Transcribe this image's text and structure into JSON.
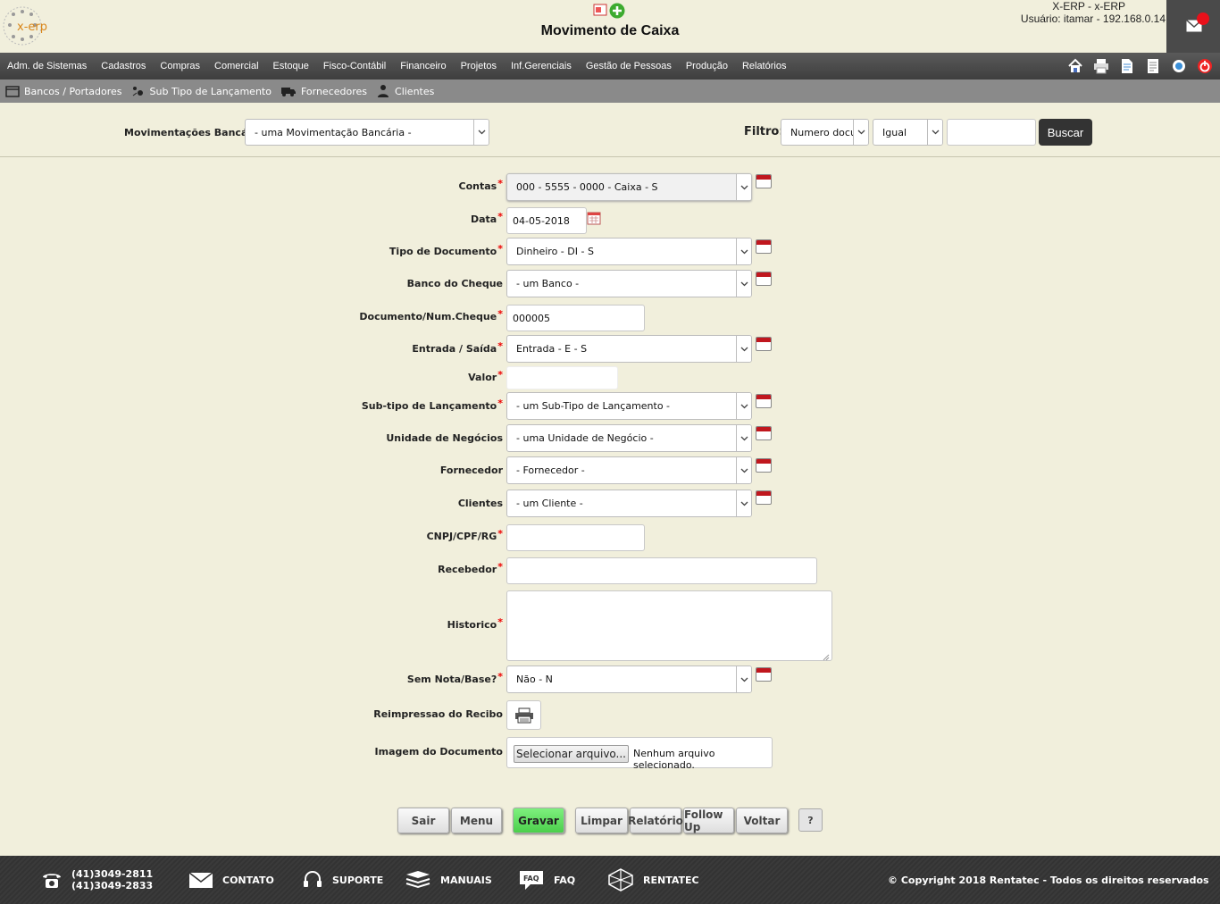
{
  "header": {
    "title": "Movimento de Caixa",
    "system_name": "X-ERP - x-ERP",
    "user_info": "Usuário: itamar - 192.168.0.14",
    "logo_text": "x-erp"
  },
  "menu": [
    "Adm. de Sistemas",
    "Cadastros",
    "Compras",
    "Comercial",
    "Estoque",
    "Fisco-Contábil",
    "Financeiro",
    "Projetos",
    "Inf.Gerenciais",
    "Gestão de Pessoas",
    "Produção",
    "Relatórios"
  ],
  "toolbar_icons": [
    "home-icon",
    "print-icon",
    "document-icon",
    "page-icon",
    "cloud-icon",
    "power-icon"
  ],
  "subnav": [
    {
      "label": "Bancos / Portadores",
      "icon": "bank-icon"
    },
    {
      "label": "Sub Tipo de Lançamento",
      "icon": "subtype-icon"
    },
    {
      "label": "Fornecedores",
      "icon": "truck-icon"
    },
    {
      "label": "Clientes",
      "icon": "client-icon"
    }
  ],
  "filter": {
    "mov_label": "Movimentações Bancárias",
    "mov_value": "- uma Movimentação Bancária -",
    "filtro_label": "Filtro:",
    "field_value": "Numero docu",
    "op_value": "Igual",
    "search_value": "",
    "search_button": "Buscar"
  },
  "form": {
    "contas": {
      "label": "Contas",
      "value": "000 - 5555 - 0000 - Caixa - S"
    },
    "data": {
      "label": "Data",
      "value": "04-05-2018"
    },
    "tipo_doc": {
      "label": "Tipo de Documento",
      "value": "Dinheiro - DI - S"
    },
    "banco_cheque": {
      "label": "Banco do Cheque",
      "value": "- um Banco -"
    },
    "documento": {
      "label": "Documento/Num.Cheque",
      "value": "000005"
    },
    "entrada_saida": {
      "label": "Entrada / Saída",
      "value": "Entrada - E - S"
    },
    "valor": {
      "label": "Valor",
      "value": ""
    },
    "sub_tipo": {
      "label": "Sub-tipo de Lançamento",
      "value": "- um Sub-Tipo de Lançamento -"
    },
    "unidade": {
      "label": "Unidade de Negócios",
      "value": "- uma Unidade de Negócio -"
    },
    "fornecedor": {
      "label": "Fornecedor",
      "value": "- Fornecedor -"
    },
    "clientes": {
      "label": "Clientes",
      "value": "- um Cliente -"
    },
    "cnpj": {
      "label": "CNPJ/CPF/RG",
      "value": ""
    },
    "recebedor": {
      "label": "Recebedor",
      "value": ""
    },
    "historico": {
      "label": "Historico",
      "value": ""
    },
    "sem_nota": {
      "label": "Sem Nota/Base?",
      "value": "Não - N"
    },
    "reimpressao": {
      "label": "Reimpressao do Recibo"
    },
    "imagem": {
      "label": "Imagem do Documento",
      "button": "Selecionar arquivo...",
      "status": "Nenhum arquivo selecionado."
    }
  },
  "buttons": {
    "sair": "Sair",
    "menu": "Menu",
    "gravar": "Gravar",
    "limpar": "Limpar",
    "relatorio": "Relatório",
    "followup": "Follow Up",
    "voltar": "Voltar",
    "help": "?"
  },
  "colors": {
    "background": "#f1efdc",
    "menubar": "#4a4a4a",
    "gravar": "#5ce05c",
    "required": "#e00000"
  },
  "footer": {
    "phone1": "(41)3049-2811",
    "phone2": "(41)3049-2833",
    "contato": "CONTATO",
    "suporte": "SUPORTE",
    "manuais": "MANUAIS",
    "faq": "FAQ",
    "faq_icon_text": "FAQ",
    "rentatec": "RENTATEC",
    "copyright": "© Copyright 2018 Rentatec - Todos os direitos reservados"
  }
}
